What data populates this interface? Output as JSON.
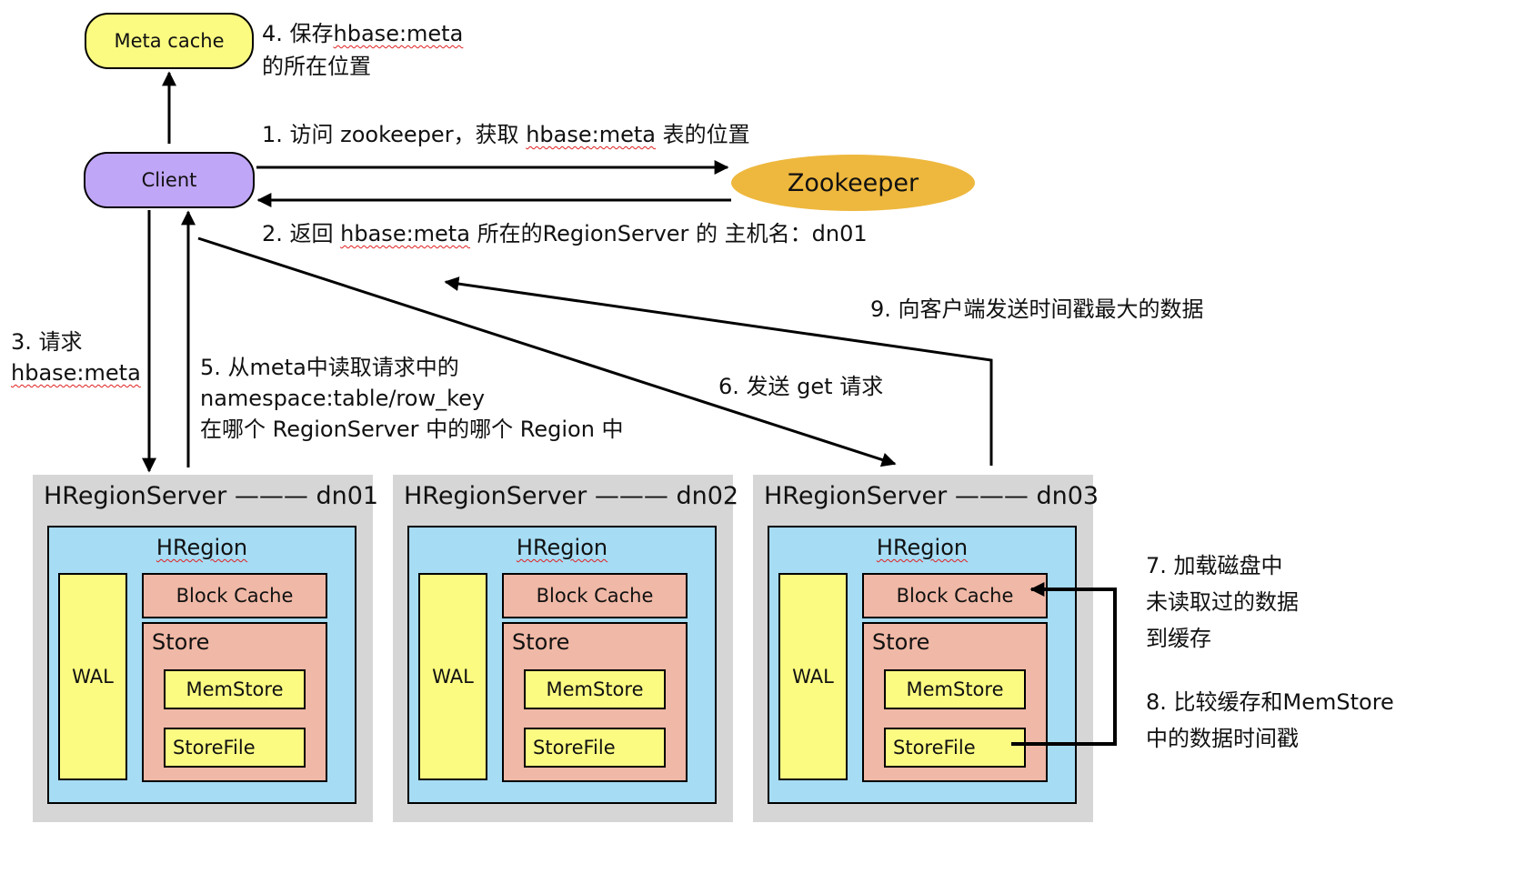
{
  "nodes": {
    "meta_cache": "Meta cache",
    "client": "Client",
    "zookeeper": "Zookeeper"
  },
  "steps": {
    "s1": {
      "prefix": "1. 访问 zookeeper，获取 ",
      "link": "hbase:meta",
      "suffix": " 表的位置"
    },
    "s2": {
      "prefix": "2. 返回 ",
      "link": "hbase:meta",
      "suffix": " 所在的RegionServer 的 主机名：dn01"
    },
    "s3": {
      "line1": "3. 请求",
      "link": "hbase:meta"
    },
    "s4": {
      "prefix": "4. 保存",
      "link": "hbase:meta",
      "line2": "的所在位置"
    },
    "s5": {
      "line1": "5. 从meta中读取请求中的",
      "line2": "namespace:table/row_key",
      "line3": "在哪个 RegionServer 中的哪个 Region 中"
    },
    "s6": "6. 发送 get 请求",
    "s7": {
      "line1": "7. 加载磁盘中",
      "line2": "未读取过的数据",
      "line3": "到缓存"
    },
    "s8": {
      "line1": "8. 比较缓存和MemStore",
      "line2": "中的数据时间戳"
    },
    "s9": "9. 向客户端发送时间戳最大的数据"
  },
  "servers": [
    {
      "title": "HRegionServer ——— dn01",
      "region": "HRegion",
      "wal": "WAL",
      "block_cache": "Block Cache",
      "store": "Store",
      "memstore": "MemStore",
      "storefile": "StoreFile"
    },
    {
      "title": "HRegionServer ——— dn02",
      "region": "HRegion",
      "wal": "WAL",
      "block_cache": "Block Cache",
      "store": "Store",
      "memstore": "MemStore",
      "storefile": "StoreFile"
    },
    {
      "title": "HRegionServer ——— dn03",
      "region": "HRegion",
      "wal": "WAL",
      "block_cache": "Block Cache",
      "store": "Store",
      "memstore": "MemStore",
      "storefile": "StoreFile"
    }
  ],
  "colors": {
    "meta_cache_fill": "#fbfb82",
    "client_fill": "#c0a6f6",
    "zookeeper_fill": "#eeb83e",
    "server_bg": "#d6d6d6",
    "region_fill": "#a6dcf4",
    "wal_fill": "#fbfb82",
    "store_fill": "#f0b8a6"
  }
}
